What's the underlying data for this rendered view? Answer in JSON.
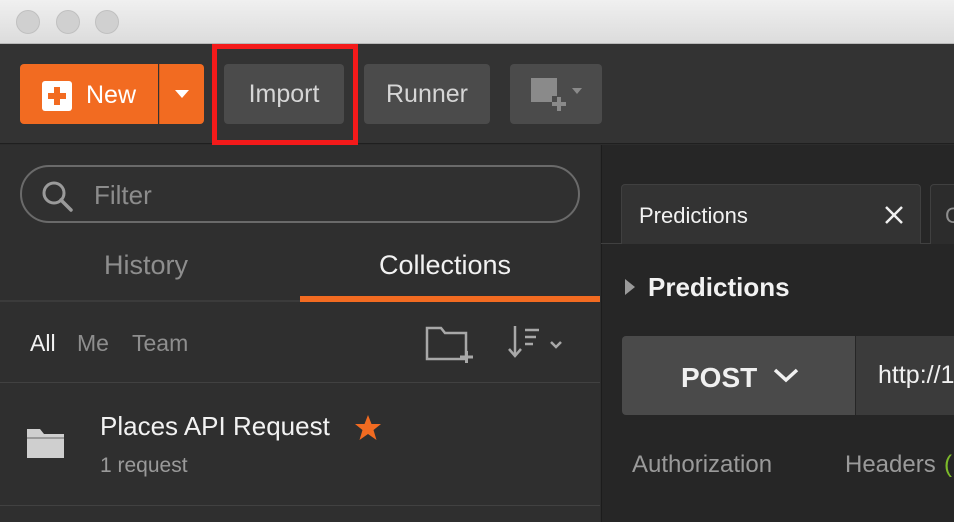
{
  "toolbar": {
    "new_label": "New",
    "import_label": "Import",
    "runner_label": "Runner"
  },
  "sidebar": {
    "filter_placeholder": "Filter",
    "tabs": {
      "history": "History",
      "collections": "Collections"
    },
    "filters": {
      "all": "All",
      "me": "Me",
      "team": "Team"
    },
    "collection": {
      "name": "Places API Request",
      "count": "1 request"
    }
  },
  "main": {
    "tab_title": "Predictions",
    "tab2_partial": "C",
    "request_name": "Predictions",
    "method": "POST",
    "url_partial": "http://1",
    "subtabs": {
      "authorization": "Authorization",
      "headers": "Headers",
      "headers_count_partial": "("
    }
  },
  "colors": {
    "accent": "#f26b21",
    "highlight": "#f41a1a",
    "star": "#f26b21"
  },
  "icons": [
    "plus-icon",
    "chevron-down-icon",
    "new-window-icon",
    "search-icon",
    "new-collection-icon",
    "sort-icon",
    "folder-icon",
    "star-icon",
    "close-icon",
    "caret-right-icon"
  ]
}
